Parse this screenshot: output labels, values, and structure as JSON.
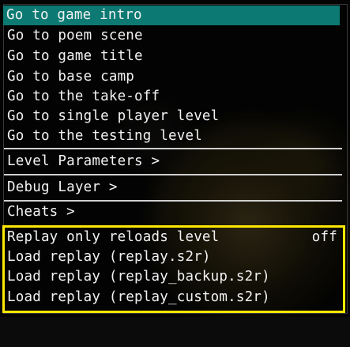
{
  "menu": {
    "items": [
      {
        "label": "Go to game intro",
        "selected": true
      },
      {
        "label": "Go to poem scene"
      },
      {
        "label": "Go to game title"
      },
      {
        "label": "Go to base camp"
      },
      {
        "label": "Go to the take-off"
      },
      {
        "label": "Go to single player level"
      },
      {
        "label": "Go to the testing level"
      }
    ],
    "submenus": [
      {
        "label": "Level Parameters >"
      },
      {
        "label": "Debug Layer >"
      },
      {
        "label": "Cheats >"
      }
    ],
    "replay": {
      "toggle_label": "Replay only reloads level",
      "toggle_value": "off",
      "load_items": [
        {
          "label": "Load replay (replay.s2r)"
        },
        {
          "label": "Load replay (replay_backup.s2r)"
        },
        {
          "label": "Load replay (replay_custom.s2r)"
        }
      ]
    }
  },
  "colors": {
    "selection": "#0c7a73",
    "highlight_box": "#ffe800",
    "text": "#f2f2f2",
    "separator": "#cfcfcf"
  }
}
